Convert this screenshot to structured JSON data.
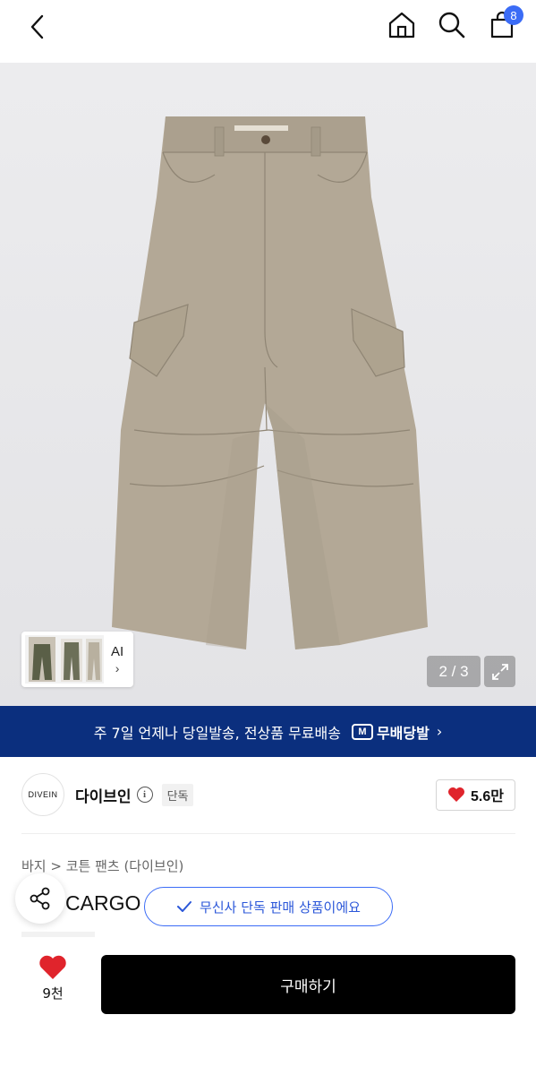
{
  "topbar": {
    "cart_count": "8"
  },
  "gallery": {
    "ai_label": "AI",
    "ai_chevron": "›",
    "counter": "2 / 3"
  },
  "banner": {
    "text": "주 7일 언제나 당일발송, 전상품 무료배송",
    "logo_mark": "M",
    "logo_text": "무배당발",
    "arrow": "›"
  },
  "brand": {
    "logo_text": "DIVEIN",
    "name": "다이브인",
    "info_glyph": "i",
    "tag": "단독",
    "likes": "5.6만"
  },
  "product": {
    "breadcrumb": "바지 > 코튼 팬츠 (다이브인)",
    "title": "V..N CARGO PANTS (BEIGE)"
  },
  "toast": {
    "text": "무신사 단독 판매 상품이에요"
  },
  "bottom": {
    "fav_count": "9천",
    "buy_label": "구매하기"
  },
  "colors": {
    "banner_bg": "#0b2f7e",
    "accent_blue": "#3b6cf6",
    "heart_red": "#e0242c",
    "pants_beige": "#b3a896",
    "buy_bg": "#000000"
  }
}
